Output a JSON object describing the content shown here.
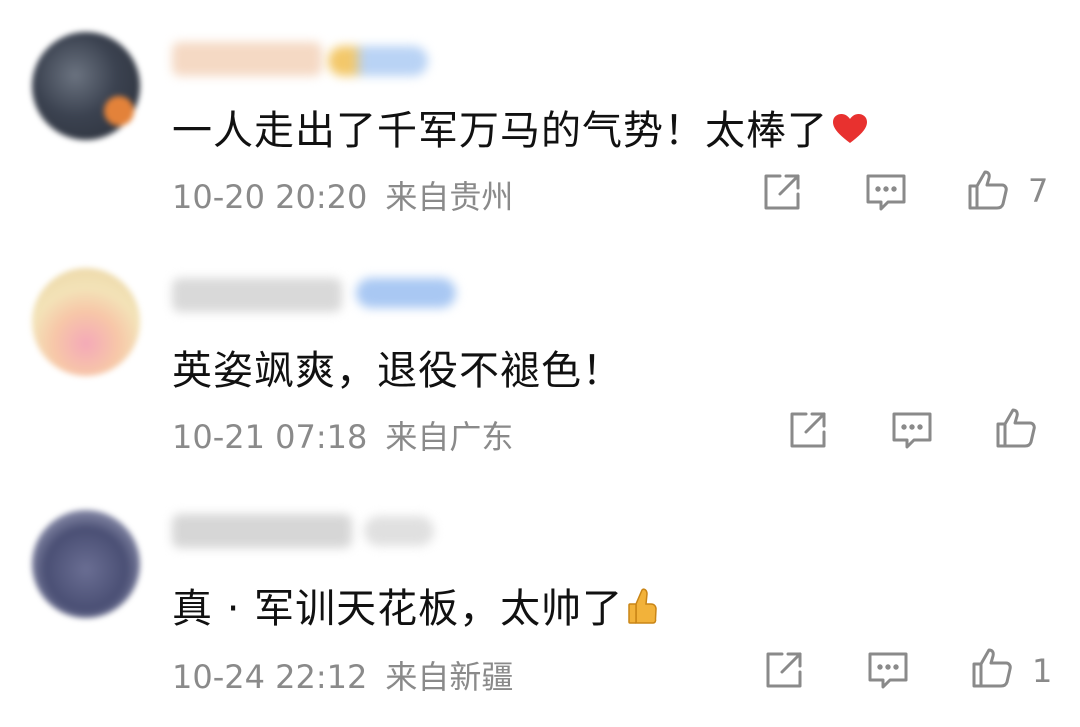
{
  "comments": [
    {
      "text": "一人走出了千军万马的气势！太棒了",
      "emoji": "heart-emoji",
      "time": "10-20 20:20",
      "location": "来自贵州",
      "likes": "7"
    },
    {
      "text": "英姿飒爽，退役不褪色！",
      "emoji": "",
      "time": "10-21 07:18",
      "location": "来自广东",
      "likes": ""
    },
    {
      "text": "真 · 军训天花板，太帅了",
      "emoji": "thumbs-up-emoji",
      "time": "10-24 22:12",
      "location": "来自新疆",
      "likes": "1"
    }
  ],
  "icons": {
    "share": "share-icon",
    "reply": "comment-icon",
    "like": "like-icon"
  },
  "colors": {
    "text": "#111111",
    "meta": "#8a8a8a",
    "icon": "#8a8a8a",
    "heart": "#e8312f",
    "vip_badge": "#a9c8f3"
  }
}
